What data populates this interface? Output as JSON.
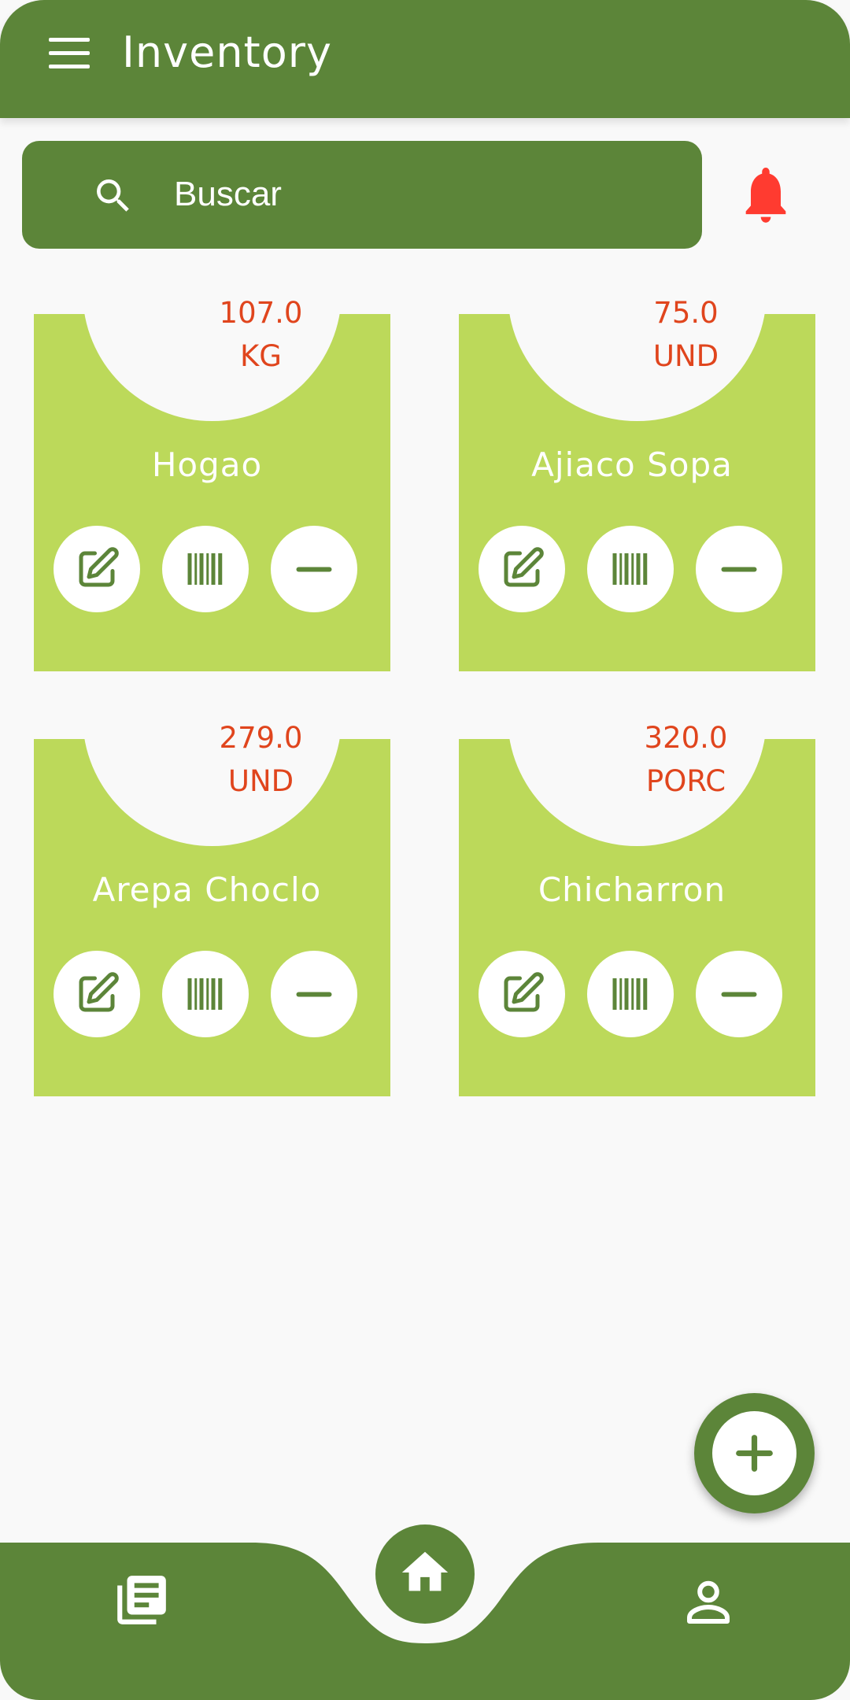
{
  "app": {
    "title": "Inventory"
  },
  "search": {
    "placeholder": "Buscar"
  },
  "colors": {
    "primary": "#5c8539",
    "card": "#bcd95a",
    "quantity": "#e0451d",
    "bell": "#ff3b30"
  },
  "items": [
    {
      "quantity": "107.0",
      "unit": "KG",
      "name": "Hogao"
    },
    {
      "quantity": "75.0",
      "unit": "UND",
      "name": "Ajiaco Sopa"
    },
    {
      "quantity": "279.0",
      "unit": "UND",
      "name": "Arepa Choclo"
    },
    {
      "quantity": "320.0",
      "unit": "PORC",
      "name": "Chicharron"
    }
  ],
  "icons": {
    "menu": "hamburger-menu-icon",
    "search": "search-icon",
    "notifications": "bell-icon",
    "edit": "edit-icon",
    "barcode": "barcode-icon",
    "decrease": "minus-icon",
    "add": "plus-icon",
    "reports": "document-list-icon",
    "home": "home-icon",
    "profile": "person-icon"
  }
}
